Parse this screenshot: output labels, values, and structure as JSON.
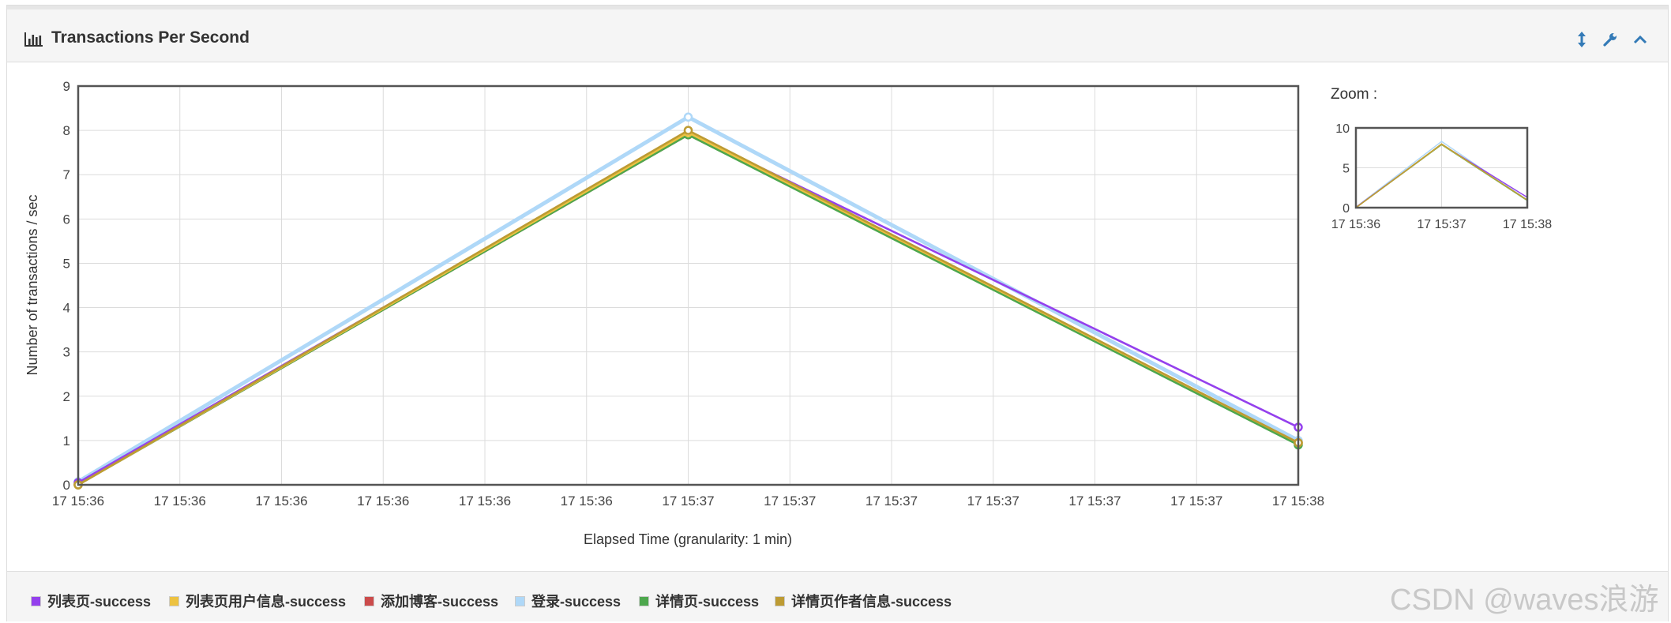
{
  "panel": {
    "title": "Transactions Per Second"
  },
  "toolbar": {
    "icons": [
      "resize-icon",
      "wrench-icon",
      "chevron-up-icon"
    ]
  },
  "zoom": {
    "label": "Zoom :",
    "y_ticks": [
      "0",
      "5",
      "10"
    ],
    "x_ticks": [
      "17 15:36",
      "17 15:37",
      "17 15:38"
    ],
    "ylim": [
      0,
      10
    ]
  },
  "watermark": "CSDN @waves浪游",
  "chart_data": {
    "type": "line",
    "title": "Transactions Per Second",
    "xlabel": "Elapsed Time (granularity: 1 min)",
    "ylabel": "Number of transactions / sec",
    "ylim": [
      0,
      9
    ],
    "y_ticks": [
      "0",
      "1",
      "2",
      "3",
      "4",
      "5",
      "6",
      "7",
      "8",
      "9"
    ],
    "x_tick_labels": [
      "17 15:36",
      "17 15:36",
      "17 15:36",
      "17 15:36",
      "17 15:36",
      "17 15:36",
      "17 15:37",
      "17 15:37",
      "17 15:37",
      "17 15:37",
      "17 15:37",
      "17 15:37",
      "17 15:38"
    ],
    "x": [
      "17 15:36",
      "17 15:37",
      "17 15:38"
    ],
    "grid": true,
    "legend_position": "bottom",
    "series": [
      {
        "name": "列表页-success",
        "color": "#9440ED",
        "values": [
          0.05,
          7.95,
          1.3
        ]
      },
      {
        "name": "列表页用户信息-success",
        "color": "#EDC240",
        "values": [
          0.0,
          7.95,
          0.95
        ]
      },
      {
        "name": "添加博客-success",
        "color": "#CB4B4B",
        "values": [
          0.0,
          7.9,
          0.95
        ]
      },
      {
        "name": "登录-success",
        "color": "#AFD8F8",
        "values": [
          0.07,
          8.3,
          1.0
        ]
      },
      {
        "name": "详情页-success",
        "color": "#4DA74D",
        "values": [
          0.0,
          7.9,
          0.9
        ]
      },
      {
        "name": "详情页作者信息-success",
        "color": "#BD9B33",
        "values": [
          0.0,
          8.0,
          0.95
        ]
      }
    ]
  }
}
